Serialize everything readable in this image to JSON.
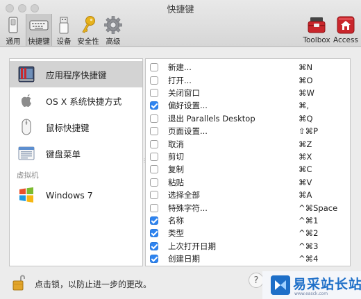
{
  "window": {
    "title": "快捷键"
  },
  "toolbar": {
    "items": [
      {
        "label": "通用",
        "icon": "switch-icon"
      },
      {
        "label": "快捷键",
        "icon": "keyboard-icon"
      },
      {
        "label": "设备",
        "icon": "usb-icon"
      },
      {
        "label": "安全性",
        "icon": "key-icon"
      },
      {
        "label": "高级",
        "icon": "gear-icon"
      },
      {
        "label": "Toolbox",
        "icon": "toolbox-icon"
      },
      {
        "label": "Access",
        "icon": "access-icon"
      }
    ]
  },
  "categories": [
    {
      "label": "应用程序快捷键",
      "icon": "parallels-app-icon"
    },
    {
      "label": "OS X 系统快捷方式",
      "icon": "apple-icon"
    },
    {
      "label": "鼠标快捷键",
      "icon": "mouse-icon"
    },
    {
      "label": "键盘菜单",
      "icon": "keyboard-menu-icon"
    }
  ],
  "vm_section": {
    "label": "虚拟机"
  },
  "vm_items": [
    {
      "label": "Windows 7",
      "icon": "windows-icon"
    }
  ],
  "shortcuts": [
    {
      "command": "新建...",
      "key": "⌘N",
      "checked": false
    },
    {
      "command": "打开...",
      "key": "⌘O",
      "checked": false
    },
    {
      "command": "关闭窗口",
      "key": "⌘W",
      "checked": false
    },
    {
      "command": "偏好设置...",
      "key": "⌘,",
      "checked": true
    },
    {
      "command": "退出 Parallels Desktop",
      "key": "⌘Q",
      "checked": false
    },
    {
      "command": "页面设置...",
      "key": "⇧⌘P",
      "checked": false
    },
    {
      "command": "取消",
      "key": "⌘Z",
      "checked": false
    },
    {
      "command": "剪切",
      "key": "⌘X",
      "checked": false
    },
    {
      "command": "复制",
      "key": "⌘C",
      "checked": false
    },
    {
      "command": "粘贴",
      "key": "⌘V",
      "checked": false
    },
    {
      "command": "选择全部",
      "key": "⌘A",
      "checked": false
    },
    {
      "command": "特殊字符...",
      "key": "^⌘Space",
      "checked": false
    },
    {
      "command": "名称",
      "key": "^⌘1",
      "checked": true
    },
    {
      "command": "类型",
      "key": "^⌘2",
      "checked": true
    },
    {
      "command": "上次打开日期",
      "key": "^⌘3",
      "checked": true
    },
    {
      "command": "创建日期",
      "key": "^⌘4",
      "checked": true
    }
  ],
  "footer": {
    "lock_text": "点击锁，以防止进一步的更改。",
    "help_label": "?"
  },
  "watermark": {
    "text": "易采站长站",
    "url": "www.easck.com"
  },
  "colors": {
    "accent": "#2e84f0",
    "selection": "#d3d3d3"
  }
}
